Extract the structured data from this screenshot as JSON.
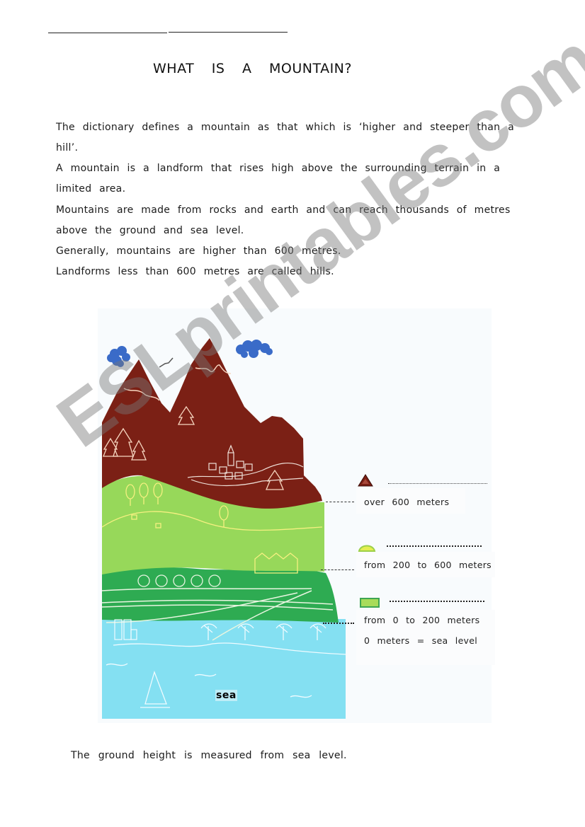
{
  "worksheet": {
    "title": "WHAT   IS   A   MOUNTAIN?",
    "paragraphs": [
      "The dictionary defines a mountain as that which is ‘higher and steeper than a",
      "hill’.",
      "A mountain is a landform that rises high above the surrounding terrain in a",
      "limited area.",
      "Mountains are made from rocks and earth and can reach thousands of metres",
      "above the ground and sea level.",
      "Generally, mountains are higher than 600 metres.",
      "Landforms less than 600 metres are called hills."
    ],
    "footer": "The ground height is measured from sea level."
  },
  "figure": {
    "sea_label": "sea",
    "legend": [
      {
        "icon": "mountain-triangle-icon",
        "blank": "………………………",
        "text": "over   600 meters",
        "color": "#7a1f14"
      },
      {
        "icon": "hill-dome-icon",
        "blank": "………………………",
        "text": "from 200 to 600 meters",
        "color": "#d8ee4a"
      },
      {
        "icon": "plain-rectangle-icon",
        "blank": "………………………",
        "text": "from 0 to 200 meters",
        "note": "0 meters = sea level",
        "color": "#8fd65a"
      }
    ],
    "colors": {
      "mountain": "#7b2015",
      "hill": "#97d85a",
      "plain": "#2eab52",
      "sea": "#84e0f2",
      "cloud": "#3a6bc8"
    }
  },
  "watermark": "ESLprintables.com"
}
